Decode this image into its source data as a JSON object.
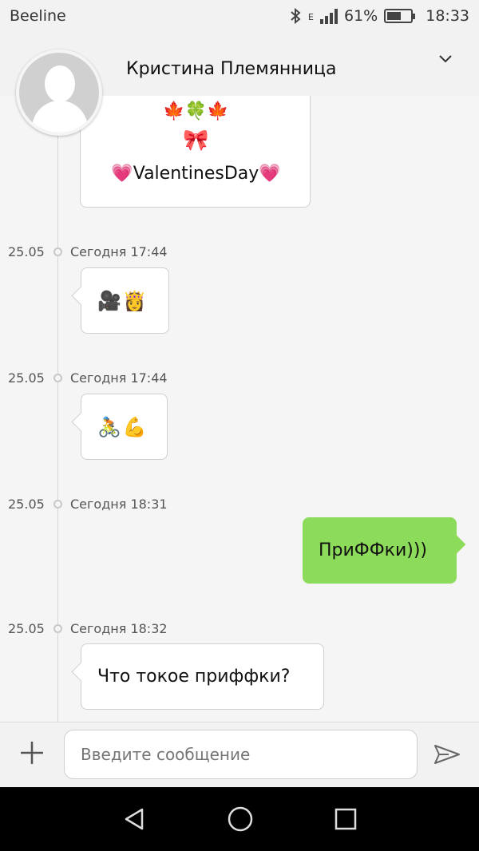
{
  "status_bar": {
    "carrier": "Beeline",
    "network": "E",
    "battery": "61%",
    "battery_level": 0.61,
    "time": "18:33"
  },
  "header": {
    "contact_name": "Кристина Племянница",
    "avatar_icon": "person-avatar-icon",
    "expand_icon": "chevron-down-icon"
  },
  "messages": [
    {
      "direction": "incoming",
      "type": "card",
      "flowers": "🍁🍀🍁",
      "bow": "🎀",
      "text": "💗ValentinesDay💗"
    },
    {
      "date": "25.05",
      "time": "Сегодня 17:44",
      "direction": "incoming",
      "text": "🎥👸"
    },
    {
      "date": "25.05",
      "time": "Сегодня 17:44",
      "direction": "incoming",
      "text": "🚴💪"
    },
    {
      "date": "25.05",
      "time": "Сегодня 18:31",
      "direction": "outgoing",
      "text": "ПриФФки)))"
    },
    {
      "date": "25.05",
      "time": "Сегодня 18:32",
      "direction": "incoming",
      "text": "Что токое приффки?"
    }
  ],
  "composer": {
    "placeholder": "Введите сообщение",
    "attach_icon": "plus-icon",
    "send_icon": "send-icon"
  },
  "colors": {
    "outgoing_bubble": "#8ddb5a",
    "incoming_bubble": "#ffffff",
    "background": "#f5f5f5"
  },
  "nav": {
    "back_icon": "back-triangle-icon",
    "home_icon": "home-circle-icon",
    "recents_icon": "recents-square-icon"
  }
}
